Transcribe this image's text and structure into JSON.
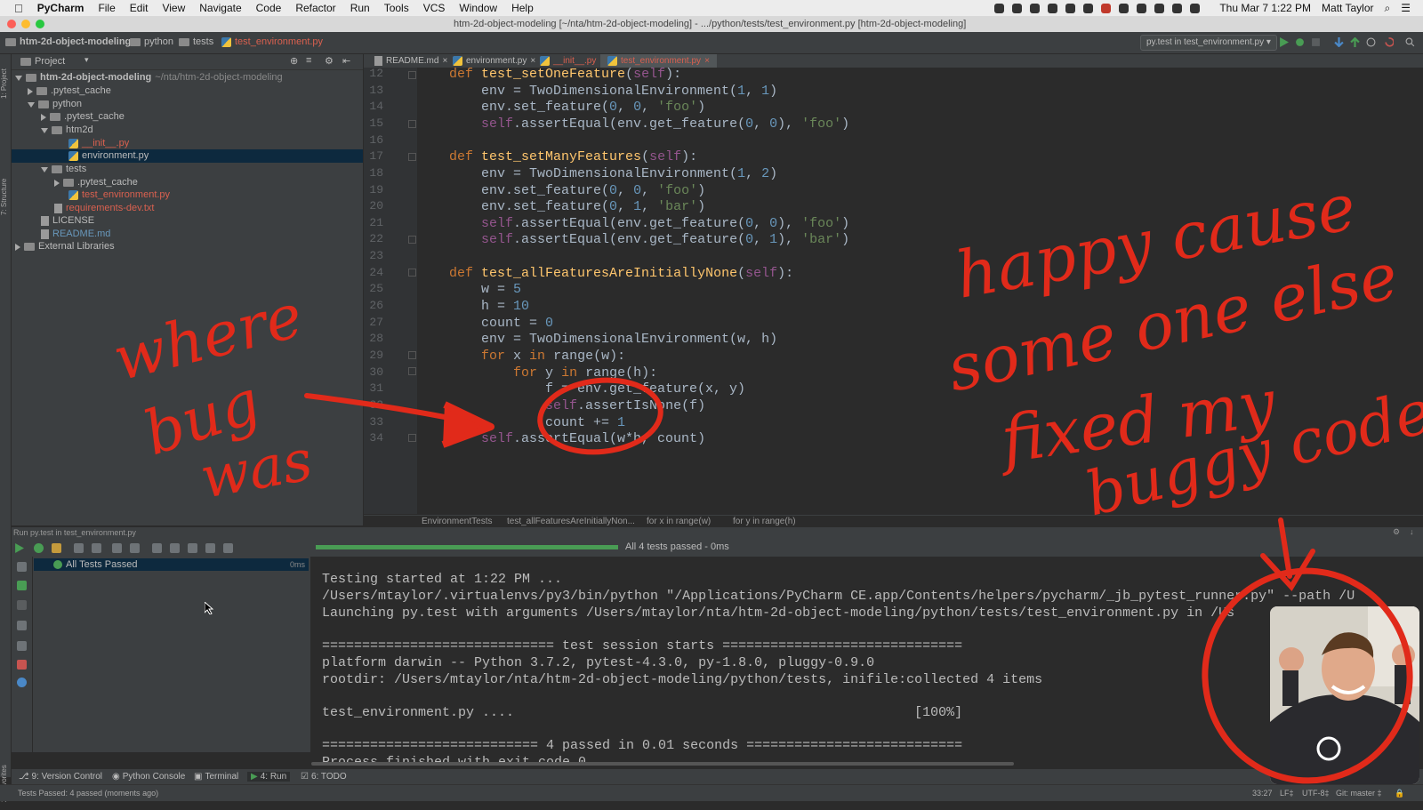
{
  "menubar": {
    "app": "PyCharm",
    "items": [
      "File",
      "Edit",
      "View",
      "Navigate",
      "Code",
      "Refactor",
      "Run",
      "Tools",
      "VCS",
      "Window",
      "Help"
    ],
    "clock": "Thu Mar 7  1:22 PM",
    "user": "Matt Taylor"
  },
  "window": {
    "title": "htm-2d-object-modeling [~/nta/htm-2d-object-modeling] - .../python/tests/test_environment.py [htm-2d-object-modeling]"
  },
  "navbar": {
    "crumbs": [
      "htm-2d-object-modeling",
      "python",
      "tests",
      "test_environment.py"
    ],
    "run_config": "py.test in test_environment.py"
  },
  "project": {
    "header": "Project",
    "root_name": "htm-2d-object-modeling",
    "root_path": "~/nta/htm-2d-object-modeling",
    "items": [
      ".pytest_cache",
      "python",
      ".pytest_cache",
      "htm2d",
      "__init__.py",
      "environment.py",
      "tests",
      ".pytest_cache",
      "test_environment.py",
      "requirements-dev.txt",
      "LICENSE",
      "README.md",
      "External Libraries"
    ]
  },
  "editor": {
    "tabs": [
      "README.md",
      "environment.py",
      "__init__.py",
      "test_environment.py"
    ],
    "active_tab": "test_environment.py",
    "line_numbers": [
      "12",
      "13",
      "14",
      "15",
      "16",
      "17",
      "18",
      "19",
      "20",
      "21",
      "22",
      "23",
      "24",
      "25",
      "26",
      "27",
      "28",
      "29",
      "30",
      "31",
      "32",
      "33",
      "34"
    ],
    "breadcrumbs": [
      "EnvironmentTests",
      "test_allFeaturesAreInitiallyNon...",
      "for x in range(w)",
      "for y in range(h)"
    ]
  },
  "run": {
    "header": "Run  py.test in test_environment.py",
    "progress": 1.0,
    "status": "All 4 tests passed - 0ms",
    "tree_item": "All Tests Passed",
    "tree_time": "0ms",
    "console": [
      "Testing started at 1:22 PM ...",
      "/Users/mtaylor/.virtualenvs/py3/bin/python \"/Applications/PyCharm CE.app/Contents/helpers/pycharm/_jb_pytest_runner.py\" --path /U",
      "Launching py.test with arguments /Users/mtaylor/nta/htm-2d-object-modeling/python/tests/test_environment.py in /Us",
      "",
      "============================= test session starts ==============================",
      "platform darwin -- Python 3.7.2, pytest-4.3.0, py-1.8.0, pluggy-0.9.0",
      "rootdir: /Users/mtaylor/nta/htm-2d-object-modeling/python/tests, inifile:collected 4 items",
      "",
      "test_environment.py ....                                                  [100%]",
      "",
      "=========================== 4 passed in 0.01 seconds ===========================",
      "Process finished with exit code 0"
    ]
  },
  "bottom_tabs": [
    "9: Version Control",
    "Python Console",
    "Terminal",
    "4: Run",
    "6: TODO"
  ],
  "status": {
    "left": "Tests Passed: 4 passed (moments ago)",
    "position": "33:27",
    "line_sep": "LF‡",
    "encoding": "UTF-8‡",
    "git": "Git: master ‡"
  },
  "annotations": {
    "left_lines": [
      "where",
      "bug",
      "was"
    ],
    "right_lines": [
      "happy cause",
      "some one else",
      "fixed my",
      "buggy code"
    ]
  },
  "colors": {
    "annotation": "#e12a1a",
    "keyword": "#cc7832",
    "function": "#ffc66d",
    "string": "#6a8759",
    "number": "#6897bb"
  }
}
